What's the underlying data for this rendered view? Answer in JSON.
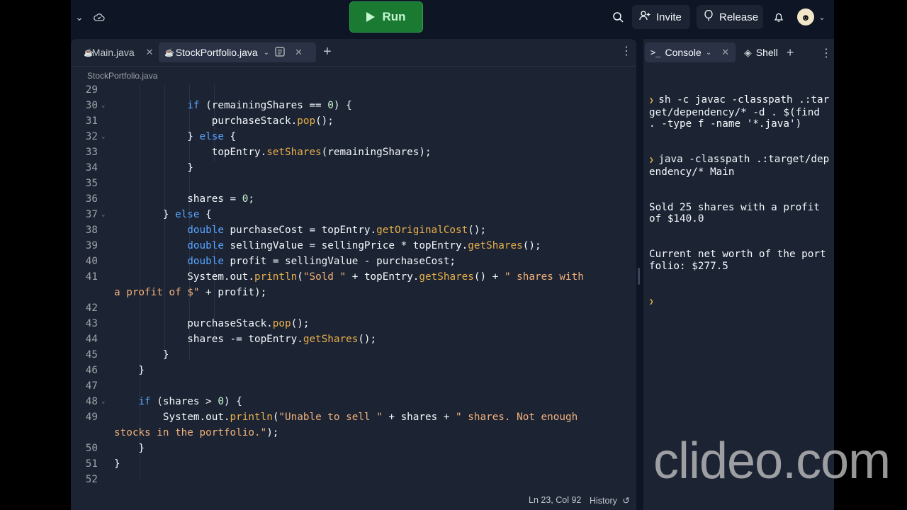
{
  "topbar": {
    "run_label": "Run",
    "invite_label": "Invite",
    "release_label": "Release"
  },
  "editor": {
    "tabs": [
      {
        "label": "Main.java"
      },
      {
        "label": "StockPortfolio.java"
      }
    ],
    "breadcrumb": "StockPortfolio.java",
    "status": {
      "position": "Ln 23, Col 92",
      "history_label": "History"
    }
  },
  "code_lines": [
    {
      "n": "29",
      "text": ""
    },
    {
      "n": "30",
      "text": "            if (remainingShares == 0) {"
    },
    {
      "n": "31",
      "text": "                purchaseStack.pop();"
    },
    {
      "n": "32",
      "text": "            } else {"
    },
    {
      "n": "33",
      "text": "                topEntry.setShares(remainingShares);"
    },
    {
      "n": "34",
      "text": "            }"
    },
    {
      "n": "35",
      "text": ""
    },
    {
      "n": "36",
      "text": "            shares = 0;"
    },
    {
      "n": "37",
      "text": "        } else {"
    },
    {
      "n": "38",
      "text": "            double purchaseCost = topEntry.getOriginalCost();"
    },
    {
      "n": "39",
      "text": "            double sellingValue = sellingPrice * topEntry.getShares();"
    },
    {
      "n": "40",
      "text": "            double profit = sellingValue - purchaseCost;"
    },
    {
      "n": "41",
      "text": "            System.out.println(\"Sold \" + topEntry.getShares() + \" shares with"
    },
    {
      "n": "",
      "text": "a profit of $\" + profit);"
    },
    {
      "n": "42",
      "text": ""
    },
    {
      "n": "43",
      "text": "            purchaseStack.pop();"
    },
    {
      "n": "44",
      "text": "            shares -= topEntry.getShares();"
    },
    {
      "n": "45",
      "text": "        }"
    },
    {
      "n": "46",
      "text": "    }"
    },
    {
      "n": "47",
      "text": ""
    },
    {
      "n": "48",
      "text": "    if (shares > 0) {"
    },
    {
      "n": "49",
      "text": "        System.out.println(\"Unable to sell \" + shares + \" shares. Not enough"
    },
    {
      "n": "",
      "text": "stocks in the portfolio.\");"
    },
    {
      "n": "50",
      "text": "    }"
    },
    {
      "n": "51",
      "text": "}"
    },
    {
      "n": "52",
      "text": ""
    }
  ],
  "console": {
    "tab_label": "Console",
    "shell_label": "Shell",
    "lines": [
      {
        "prompt": true,
        "text": "sh -c javac -classpath .:target/dependency/* -d . $(find . -type f -name '*.java')"
      },
      {
        "prompt": true,
        "text": "java -classpath .:target/dependency/* Main"
      },
      {
        "prompt": false,
        "text": "Sold 25 shares with a profit of $140.0"
      },
      {
        "prompt": false,
        "text": "Current net worth of the portfolio: $277.5"
      }
    ]
  },
  "watermark": "clideo.com"
}
